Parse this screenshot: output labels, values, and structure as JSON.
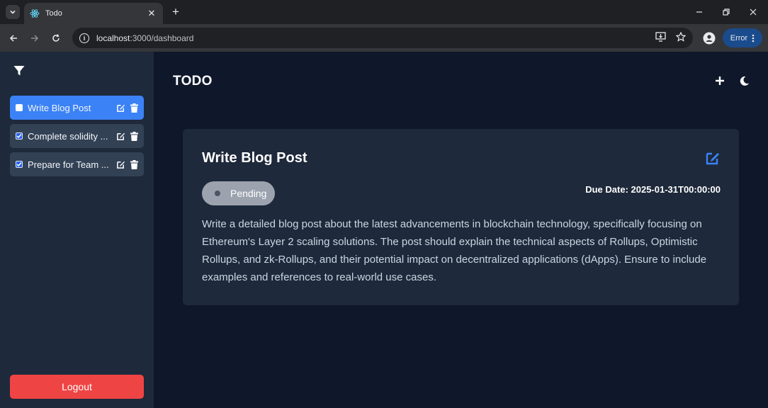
{
  "browser": {
    "tab_title": "Todo",
    "url_host": "localhost",
    "url_path": ":3000/dashboard",
    "error_label": "Error"
  },
  "sidebar": {
    "todos": [
      {
        "label": "Write Blog Post",
        "checked": false,
        "active": true
      },
      {
        "label": "Complete solidity ...",
        "checked": true,
        "active": false
      },
      {
        "label": "Prepare for Team ...",
        "checked": true,
        "active": false
      }
    ],
    "logout_label": "Logout"
  },
  "main": {
    "title": "TODO"
  },
  "detail": {
    "title": "Write Blog Post",
    "status": "Pending",
    "due_date": "Due Date: 2025-01-31T00:00:00",
    "description": "Write a detailed blog post about the latest advancements in blockchain technology, specifically focusing on Ethereum's Layer 2 scaling solutions. The post should explain the technical aspects of Rollups, Optimistic Rollups, and zk-Rollups, and their potential impact on decentralized applications (dApps). Ensure to include examples and references to real-world use cases."
  },
  "colors": {
    "accent": "#3b82f6",
    "danger": "#ef4444",
    "sidebar_bg": "#1e293b",
    "main_bg": "#0f172a",
    "pending_pill": "#9ca3af"
  },
  "icons": [
    "filter-icon",
    "edit-icon",
    "trash-icon",
    "plus-icon",
    "moon-icon"
  ]
}
